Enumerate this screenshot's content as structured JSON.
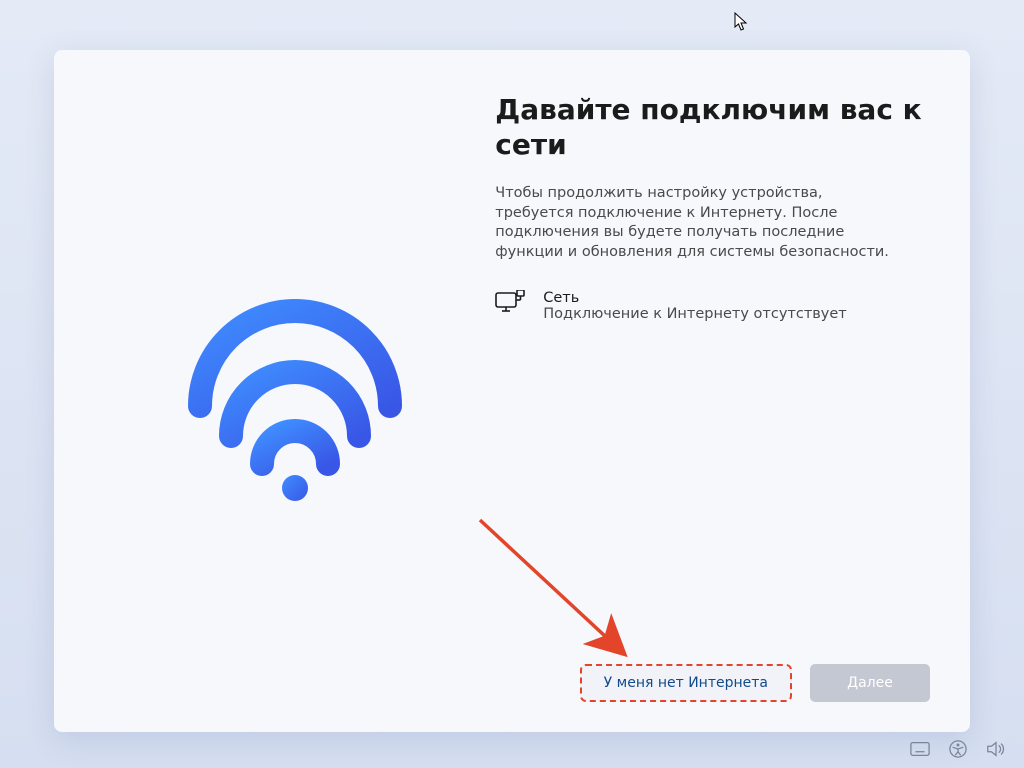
{
  "page": {
    "title": "Давайте подключим вас к сети",
    "subtitle": "Чтобы продолжить настройку устройства, требуется подключение к Интернету. После подключения вы будете получать последние функции и обновления для системы безопасности."
  },
  "network": {
    "label": "Сеть",
    "status": "Подключение к Интернету отсутствует"
  },
  "buttons": {
    "no_internet": "У меня нет Интернета",
    "next": "Далее"
  },
  "colors": {
    "wifi_gradient_start": "#3a86ff",
    "wifi_gradient_end": "#3c5eec",
    "highlight": "#e2452a"
  },
  "icons": {
    "wifi": "wifi-icon",
    "network": "monitor-ethernet-icon",
    "keyboard": "keyboard-icon",
    "accessibility": "accessibility-icon",
    "volume": "volume-icon",
    "cursor": "cursor-default-icon"
  }
}
